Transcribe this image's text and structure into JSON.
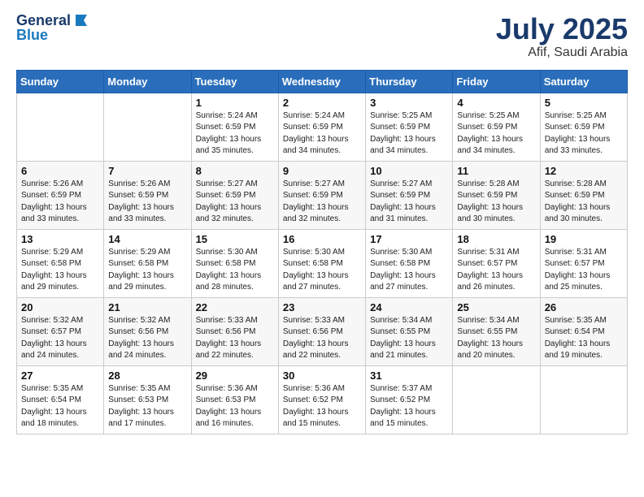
{
  "logo": {
    "line1": "General",
    "line2": "Blue"
  },
  "title": "July 2025",
  "subtitle": "Afif, Saudi Arabia",
  "weekdays": [
    "Sunday",
    "Monday",
    "Tuesday",
    "Wednesday",
    "Thursday",
    "Friday",
    "Saturday"
  ],
  "weeks": [
    [
      null,
      null,
      {
        "day": "1",
        "sunrise": "5:24 AM",
        "sunset": "6:59 PM",
        "daylight": "13 hours and 35 minutes."
      },
      {
        "day": "2",
        "sunrise": "5:24 AM",
        "sunset": "6:59 PM",
        "daylight": "13 hours and 34 minutes."
      },
      {
        "day": "3",
        "sunrise": "5:25 AM",
        "sunset": "6:59 PM",
        "daylight": "13 hours and 34 minutes."
      },
      {
        "day": "4",
        "sunrise": "5:25 AM",
        "sunset": "6:59 PM",
        "daylight": "13 hours and 34 minutes."
      },
      {
        "day": "5",
        "sunrise": "5:25 AM",
        "sunset": "6:59 PM",
        "daylight": "13 hours and 33 minutes."
      }
    ],
    [
      {
        "day": "6",
        "sunrise": "5:26 AM",
        "sunset": "6:59 PM",
        "daylight": "13 hours and 33 minutes."
      },
      {
        "day": "7",
        "sunrise": "5:26 AM",
        "sunset": "6:59 PM",
        "daylight": "13 hours and 33 minutes."
      },
      {
        "day": "8",
        "sunrise": "5:27 AM",
        "sunset": "6:59 PM",
        "daylight": "13 hours and 32 minutes."
      },
      {
        "day": "9",
        "sunrise": "5:27 AM",
        "sunset": "6:59 PM",
        "daylight": "13 hours and 32 minutes."
      },
      {
        "day": "10",
        "sunrise": "5:27 AM",
        "sunset": "6:59 PM",
        "daylight": "13 hours and 31 minutes."
      },
      {
        "day": "11",
        "sunrise": "5:28 AM",
        "sunset": "6:59 PM",
        "daylight": "13 hours and 30 minutes."
      },
      {
        "day": "12",
        "sunrise": "5:28 AM",
        "sunset": "6:59 PM",
        "daylight": "13 hours and 30 minutes."
      }
    ],
    [
      {
        "day": "13",
        "sunrise": "5:29 AM",
        "sunset": "6:58 PM",
        "daylight": "13 hours and 29 minutes."
      },
      {
        "day": "14",
        "sunrise": "5:29 AM",
        "sunset": "6:58 PM",
        "daylight": "13 hours and 29 minutes."
      },
      {
        "day": "15",
        "sunrise": "5:30 AM",
        "sunset": "6:58 PM",
        "daylight": "13 hours and 28 minutes."
      },
      {
        "day": "16",
        "sunrise": "5:30 AM",
        "sunset": "6:58 PM",
        "daylight": "13 hours and 27 minutes."
      },
      {
        "day": "17",
        "sunrise": "5:30 AM",
        "sunset": "6:58 PM",
        "daylight": "13 hours and 27 minutes."
      },
      {
        "day": "18",
        "sunrise": "5:31 AM",
        "sunset": "6:57 PM",
        "daylight": "13 hours and 26 minutes."
      },
      {
        "day": "19",
        "sunrise": "5:31 AM",
        "sunset": "6:57 PM",
        "daylight": "13 hours and 25 minutes."
      }
    ],
    [
      {
        "day": "20",
        "sunrise": "5:32 AM",
        "sunset": "6:57 PM",
        "daylight": "13 hours and 24 minutes."
      },
      {
        "day": "21",
        "sunrise": "5:32 AM",
        "sunset": "6:56 PM",
        "daylight": "13 hours and 24 minutes."
      },
      {
        "day": "22",
        "sunrise": "5:33 AM",
        "sunset": "6:56 PM",
        "daylight": "13 hours and 22 minutes."
      },
      {
        "day": "23",
        "sunrise": "5:33 AM",
        "sunset": "6:56 PM",
        "daylight": "13 hours and 22 minutes."
      },
      {
        "day": "24",
        "sunrise": "5:34 AM",
        "sunset": "6:55 PM",
        "daylight": "13 hours and 21 minutes."
      },
      {
        "day": "25",
        "sunrise": "5:34 AM",
        "sunset": "6:55 PM",
        "daylight": "13 hours and 20 minutes."
      },
      {
        "day": "26",
        "sunrise": "5:35 AM",
        "sunset": "6:54 PM",
        "daylight": "13 hours and 19 minutes."
      }
    ],
    [
      {
        "day": "27",
        "sunrise": "5:35 AM",
        "sunset": "6:54 PM",
        "daylight": "13 hours and 18 minutes."
      },
      {
        "day": "28",
        "sunrise": "5:35 AM",
        "sunset": "6:53 PM",
        "daylight": "13 hours and 17 minutes."
      },
      {
        "day": "29",
        "sunrise": "5:36 AM",
        "sunset": "6:53 PM",
        "daylight": "13 hours and 16 minutes."
      },
      {
        "day": "30",
        "sunrise": "5:36 AM",
        "sunset": "6:52 PM",
        "daylight": "13 hours and 15 minutes."
      },
      {
        "day": "31",
        "sunrise": "5:37 AM",
        "sunset": "6:52 PM",
        "daylight": "13 hours and 15 minutes."
      },
      null,
      null
    ]
  ]
}
